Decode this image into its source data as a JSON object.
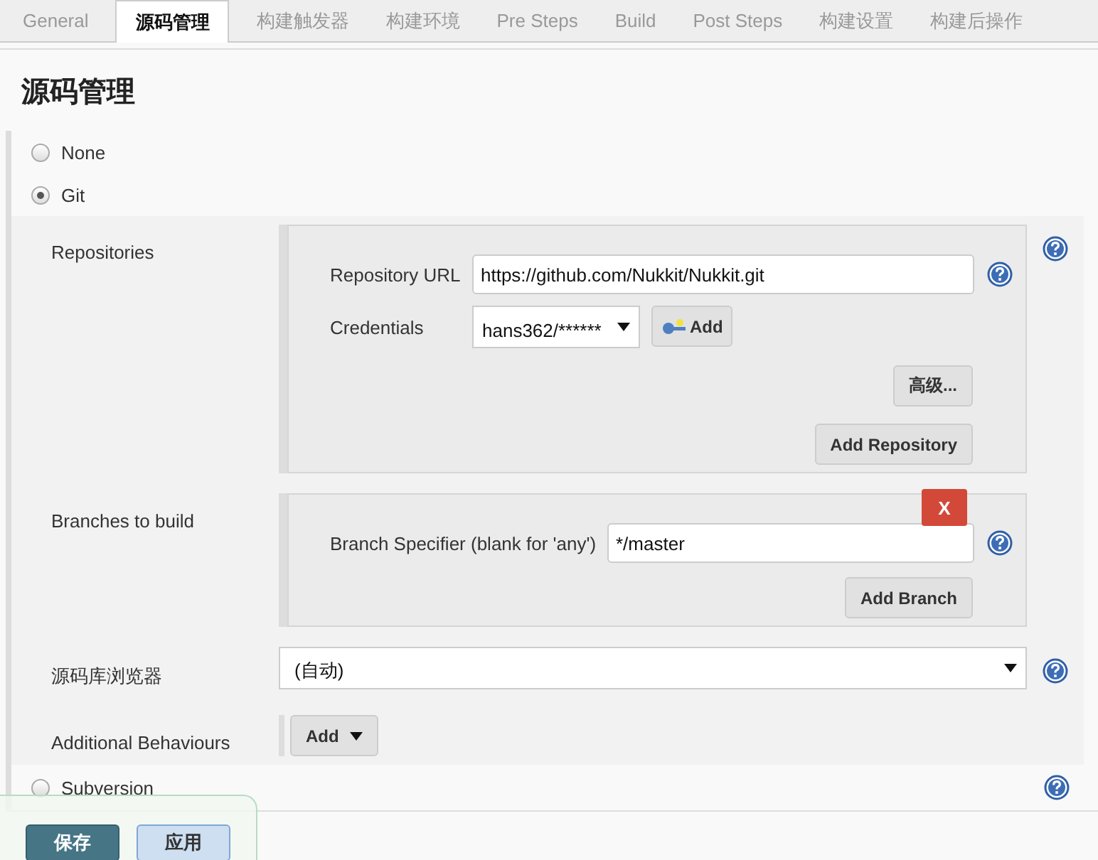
{
  "tabs": [
    {
      "label": "General",
      "selected": false
    },
    {
      "label": "源码管理",
      "selected": true
    },
    {
      "label": "构建触发器",
      "selected": false
    },
    {
      "label": "构建环境",
      "selected": false
    },
    {
      "label": "Pre Steps",
      "selected": false
    },
    {
      "label": "Build",
      "selected": false
    },
    {
      "label": "Post Steps",
      "selected": false
    },
    {
      "label": "构建设置",
      "selected": false
    },
    {
      "label": "构建后操作",
      "selected": false
    }
  ],
  "section_title": "源码管理",
  "scm_options": [
    {
      "label": "None",
      "selected": false
    },
    {
      "label": "Git",
      "selected": true
    },
    {
      "label": "Subversion",
      "selected": false
    }
  ],
  "git": {
    "repositories": {
      "label": "Repositories",
      "url_label": "Repository URL",
      "url": "https://github.com/Nukkit/Nukkit.git",
      "credentials_label": "Credentials",
      "credentials": "hans362/******",
      "add_button": "Add",
      "advanced_button": "高级...",
      "add_repository_button": "Add Repository"
    },
    "branches": {
      "label": "Branches to build",
      "delete_button": "X",
      "specifier_label": "Branch Specifier (blank for 'any')",
      "specifier": "*/master",
      "add_branch_button": "Add Branch"
    },
    "browser": {
      "label": "源码库浏览器",
      "value": "(自动)"
    },
    "behaviours": {
      "label": "Additional Behaviours",
      "add_button": "Add"
    }
  },
  "save_bar": {
    "buttons": [
      {
        "label": "保存",
        "kind": "primary"
      },
      {
        "label": "应用",
        "kind": "secondary"
      }
    ]
  }
}
